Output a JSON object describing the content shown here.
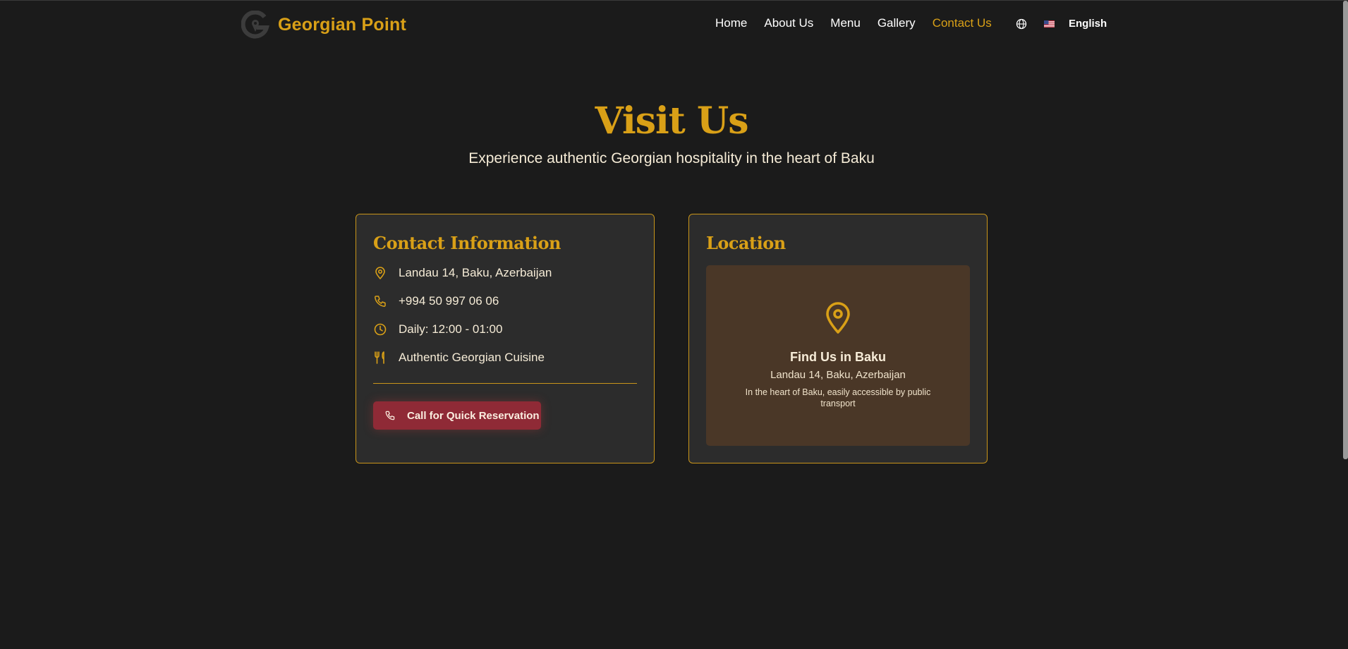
{
  "header": {
    "brand_name": "Georgian Point",
    "nav": [
      {
        "label": "Home",
        "active": false
      },
      {
        "label": "About Us",
        "active": false
      },
      {
        "label": "Menu",
        "active": false
      },
      {
        "label": "Gallery",
        "active": false
      },
      {
        "label": "Contact Us",
        "active": true
      }
    ],
    "language": {
      "label": "English",
      "icon": "globe-icon",
      "flag": "us-flag-icon"
    }
  },
  "hero": {
    "title": "Visit Us",
    "subtitle": "Experience authentic Georgian hospitality in the heart of Baku"
  },
  "contact": {
    "title": "Contact Information",
    "items": [
      {
        "icon": "map-pin-icon",
        "text": "Landau 14, Baku, Azerbaijan"
      },
      {
        "icon": "phone-icon",
        "text": "+994 50 997 06 06"
      },
      {
        "icon": "clock-icon",
        "text": "Daily: 12:00 - 01:00"
      },
      {
        "icon": "utensils-icon",
        "text": "Authentic Georgian Cuisine"
      }
    ],
    "button_label": "Call for Quick Reservation"
  },
  "location": {
    "title": "Location",
    "map_title": "Find Us in Baku",
    "map_address": "Landau 14, Baku, Azerbaijan",
    "map_note": "In the heart of Baku, easily accessible by public transport"
  },
  "colors": {
    "background": "#1b1b1b",
    "accent_gold": "#d9a017",
    "card_bg": "#2c2c2c",
    "button_red": "#8f2a36",
    "map_bg": "#4a3727"
  }
}
